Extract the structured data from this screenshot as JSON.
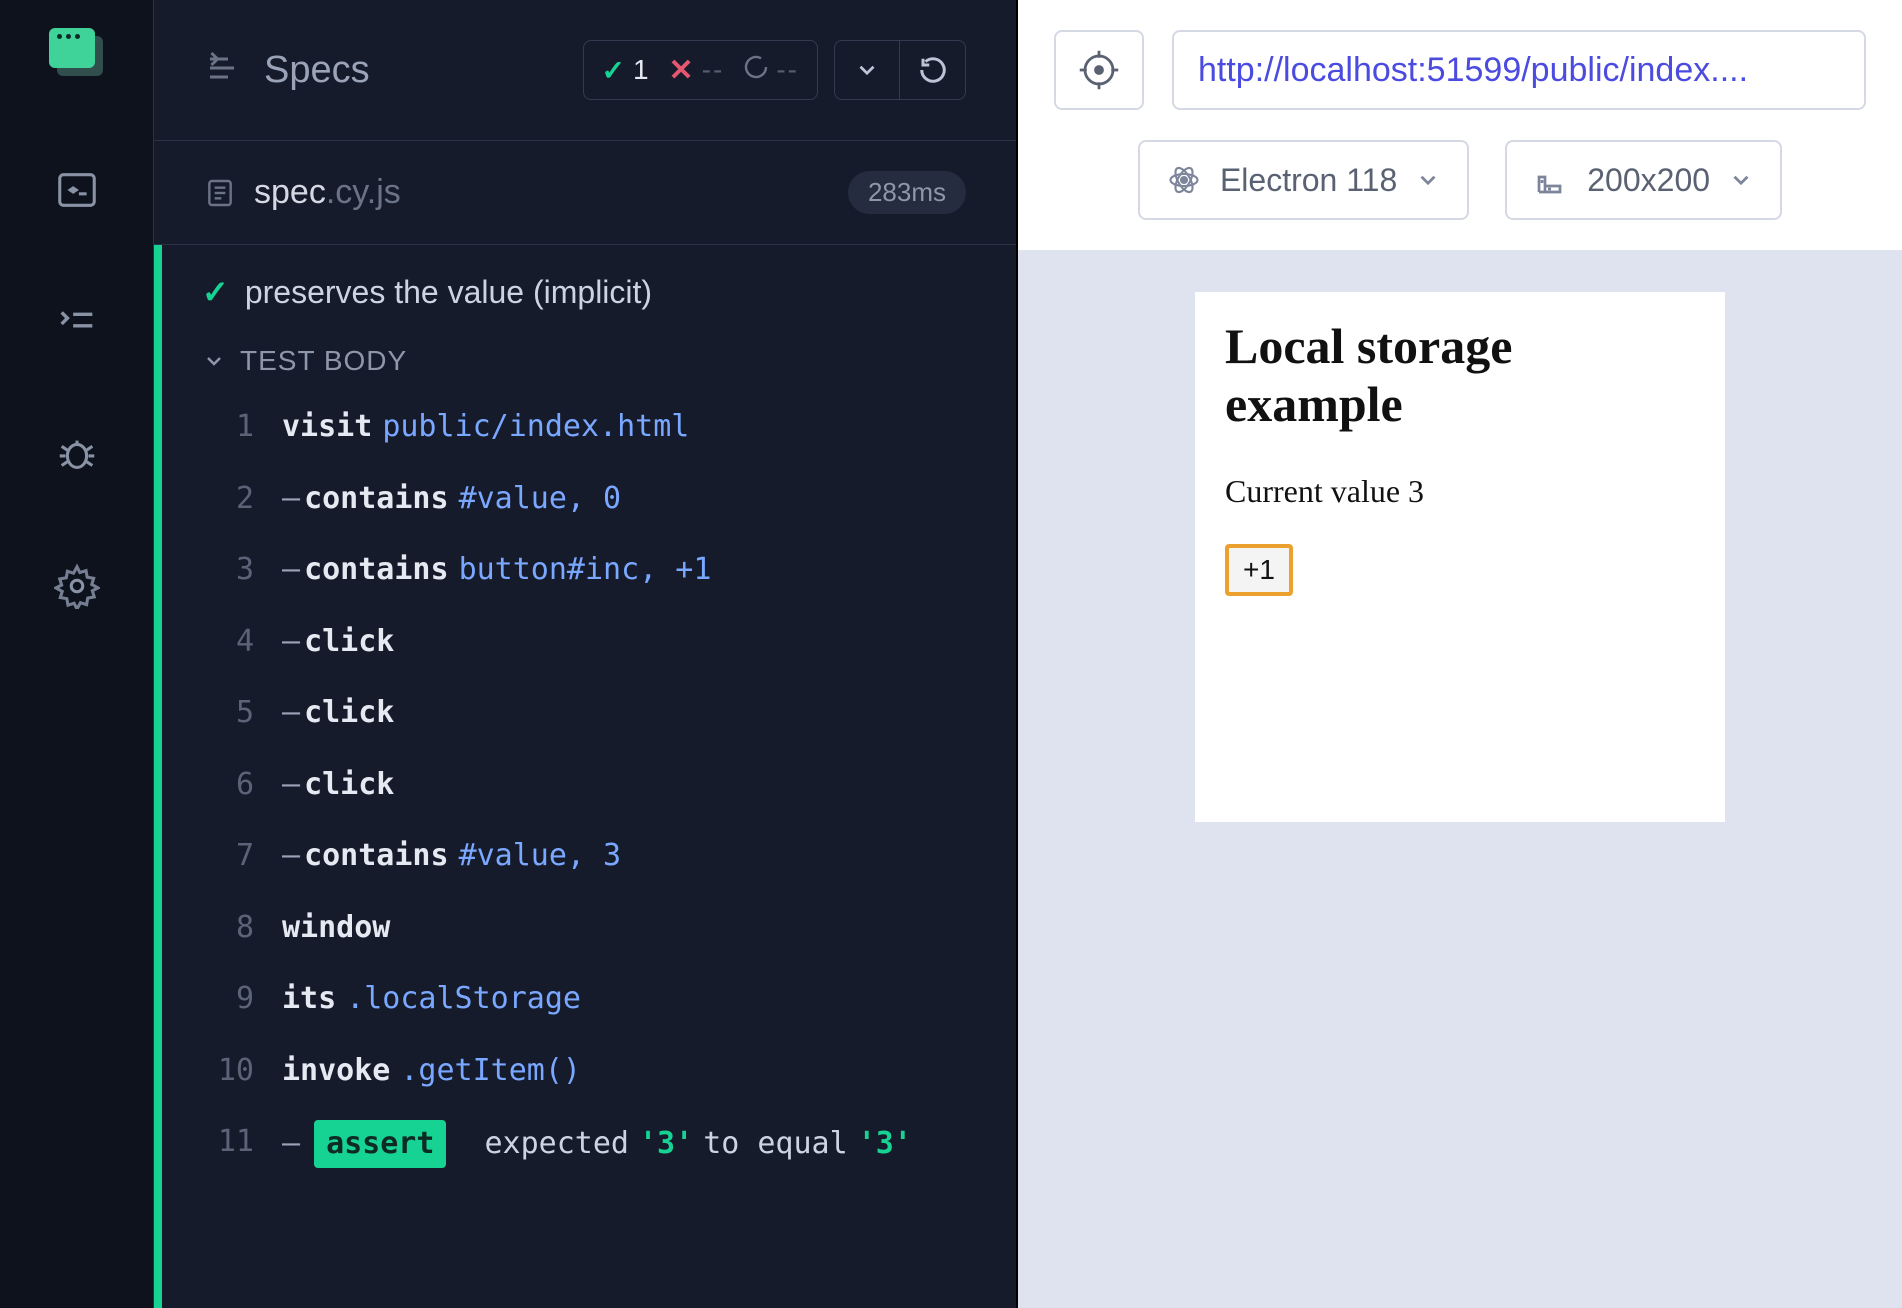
{
  "header": {
    "title": "Specs",
    "passed_count": "1",
    "failed_count": "--",
    "pending_count": "--"
  },
  "spec": {
    "filename_base": "spec",
    "filename_ext": ".cy.js",
    "duration": "283ms"
  },
  "test": {
    "title": "preserves the value (implicit)",
    "body_label": "TEST BODY"
  },
  "commands": [
    {
      "n": "1",
      "dash": false,
      "name": "visit",
      "args": "public/index.html"
    },
    {
      "n": "2",
      "dash": true,
      "name": "contains",
      "args": "#value, 0"
    },
    {
      "n": "3",
      "dash": true,
      "name": "contains",
      "args": "button#inc, +1"
    },
    {
      "n": "4",
      "dash": true,
      "name": "click",
      "args": ""
    },
    {
      "n": "5",
      "dash": true,
      "name": "click",
      "args": ""
    },
    {
      "n": "6",
      "dash": true,
      "name": "click",
      "args": ""
    },
    {
      "n": "7",
      "dash": true,
      "name": "contains",
      "args": "#value, 3"
    },
    {
      "n": "8",
      "dash": false,
      "name": "window",
      "args": ""
    },
    {
      "n": "9",
      "dash": false,
      "name": "its",
      "args": ".localStorage"
    },
    {
      "n": "10",
      "dash": false,
      "name": "invoke",
      "args": ".getItem()"
    }
  ],
  "assert_cmd": {
    "n": "11",
    "pill": "assert",
    "w1": "expected",
    "lit1": "'3'",
    "w2": "to equal",
    "lit2": "'3'"
  },
  "aut": {
    "url": "http://localhost:51599/public/index....",
    "browser_label": "Electron 118",
    "viewport_label": "200x200",
    "page": {
      "h1": "Local storage example",
      "current_value_label": "Current value ",
      "current_value": "3",
      "inc_button": "+1"
    }
  }
}
